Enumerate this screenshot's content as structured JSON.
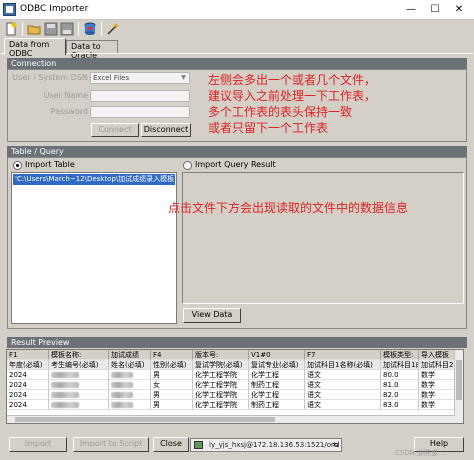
{
  "window": {
    "title": "ODBC Importer",
    "min_glyph": "—",
    "max_glyph": "☐",
    "close_glyph": "✕"
  },
  "tabs": [
    {
      "label": "Data from ODBC",
      "active": true
    },
    {
      "label": "Data to Oracle",
      "active": false
    }
  ],
  "connection": {
    "header": "Connection",
    "dsn_label": "User / System DSN",
    "dsn_value": "Excel Files",
    "username_label": "User Name",
    "password_label": "Password",
    "connect_label": "Connect",
    "disconnect_label": "Disconnect"
  },
  "note_top": [
    "左侧会多出一个或者几个文件，",
    "建议导入之前处理一下工作表，",
    "多个工作表的表头保持一致",
    "或者只留下一个工作表"
  ],
  "table_query": {
    "header": "Table / Query",
    "import_table_label": "Import Table",
    "import_query_label": "Import Query Result",
    "selected_file": "'C:\\Users\\March~12\\Desktop\\加试成绩录入模板 (",
    "view_data_label": "View Data"
  },
  "note_mid": "点击文件下方会出现读取的文件中的数据信息",
  "result_preview": {
    "header": "Result Preview",
    "columns": [
      "F1",
      "模板名称:",
      "加试成绩",
      "F4",
      "版本号:",
      "V1#0",
      "F7",
      "模板类型:",
      "导入模板"
    ],
    "row2": [
      "年度(必填)",
      "考生编号(必填)",
      "姓名(必填)",
      "性别(必填)",
      "复试学院(必填)",
      "复试专业(必填)",
      "加试科目1名称(必填)",
      "加试科目1成绩",
      "加试科目2名"
    ],
    "rows": [
      [
        "2024",
        "",
        "",
        "男",
        "化学工程学院",
        "化学工程",
        "语文",
        "80.0",
        "数学"
      ],
      [
        "2024",
        "",
        "",
        "女",
        "化学工程学院",
        "制药工程",
        "语文",
        "81.0",
        "数学"
      ],
      [
        "2024",
        "",
        "",
        "男",
        "化学工程学院",
        "化学工程",
        "语文",
        "82.0",
        "数学"
      ],
      [
        "2024",
        "",
        "",
        "男",
        "化学工程学院",
        "制药工程",
        "语文",
        "83.0",
        "数学"
      ]
    ]
  },
  "bottom": {
    "import_label": "Import",
    "import_script_label": "Import to Script",
    "close_label": "Close",
    "connection_string": "ly_yjs_hxsj@172.18.136.53:1521/orcl",
    "help_label": "Help",
    "watermark": "CSDN @陈俊 ..."
  }
}
